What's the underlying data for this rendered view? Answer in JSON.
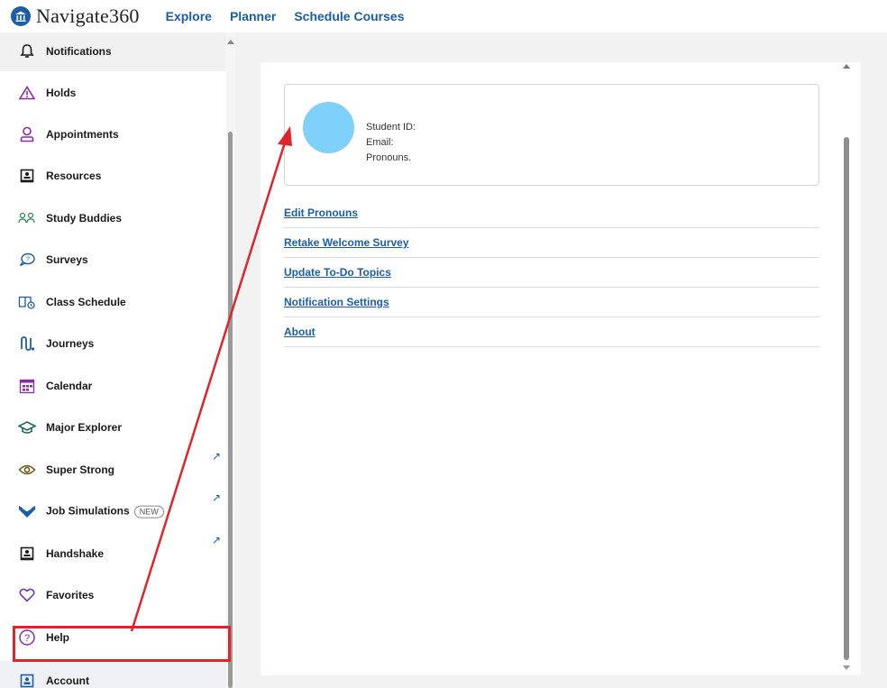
{
  "app": {
    "logo_text": "Navigate360",
    "nav": [
      "Explore",
      "Planner",
      "Schedule Courses"
    ]
  },
  "sidebar": {
    "items": [
      {
        "label": "Notifications",
        "icon": "bell-icon",
        "color": "#1a1a1a"
      },
      {
        "label": "Holds",
        "icon": "warning-triangle-icon",
        "color": "#8a2aa8"
      },
      {
        "label": "Appointments",
        "icon": "person-icon",
        "color": "#8a2aa8"
      },
      {
        "label": "Resources",
        "icon": "resources-board-icon",
        "color": "#1a1a1a"
      },
      {
        "label": "Study Buddies",
        "icon": "people-group-icon",
        "color": "#2e8b4a"
      },
      {
        "label": "Surveys",
        "icon": "question-bubble-icon",
        "color": "#1b5ea8"
      },
      {
        "label": "Class Schedule",
        "icon": "book-clock-icon",
        "color": "#1b5ea8"
      },
      {
        "label": "Journeys",
        "icon": "path-icon",
        "color": "#1b5ea8"
      },
      {
        "label": "Calendar",
        "icon": "calendar-icon",
        "color": "#8a2aa8"
      },
      {
        "label": "Major Explorer",
        "icon": "graduation-cap-icon",
        "color": "#1e6b5a"
      },
      {
        "label": "Super Strong",
        "icon": "eye-icon",
        "color": "#6b5a1e"
      },
      {
        "label": "Job Simulations",
        "icon": "chevron-logo-icon",
        "color": "#1b5ea8",
        "badge": "NEW"
      },
      {
        "label": "Handshake",
        "icon": "handshake-board-icon",
        "color": "#1a1a1a"
      },
      {
        "label": "Favorites",
        "icon": "heart-icon",
        "color": "#6a3fb0"
      },
      {
        "label": "Help",
        "icon": "help-circle-icon",
        "color": "#8a2aa8"
      },
      {
        "label": "Account",
        "icon": "account-card-icon",
        "color": "#1b5ea8",
        "active": true
      }
    ],
    "external_link_icon": "external-arrow-icon"
  },
  "profile": {
    "student_id_label": "Student ID:",
    "email_label": "Email:",
    "pronouns_label": "Pronouns."
  },
  "links": [
    "Edit Pronouns",
    "Retake Welcome Survey",
    "Update To-Do Topics",
    "Notification Settings",
    "About"
  ],
  "colors": {
    "brand_blue": "#1b5ea8",
    "avatar": "#7fd0fb",
    "annotation_red": "#e0242a"
  }
}
